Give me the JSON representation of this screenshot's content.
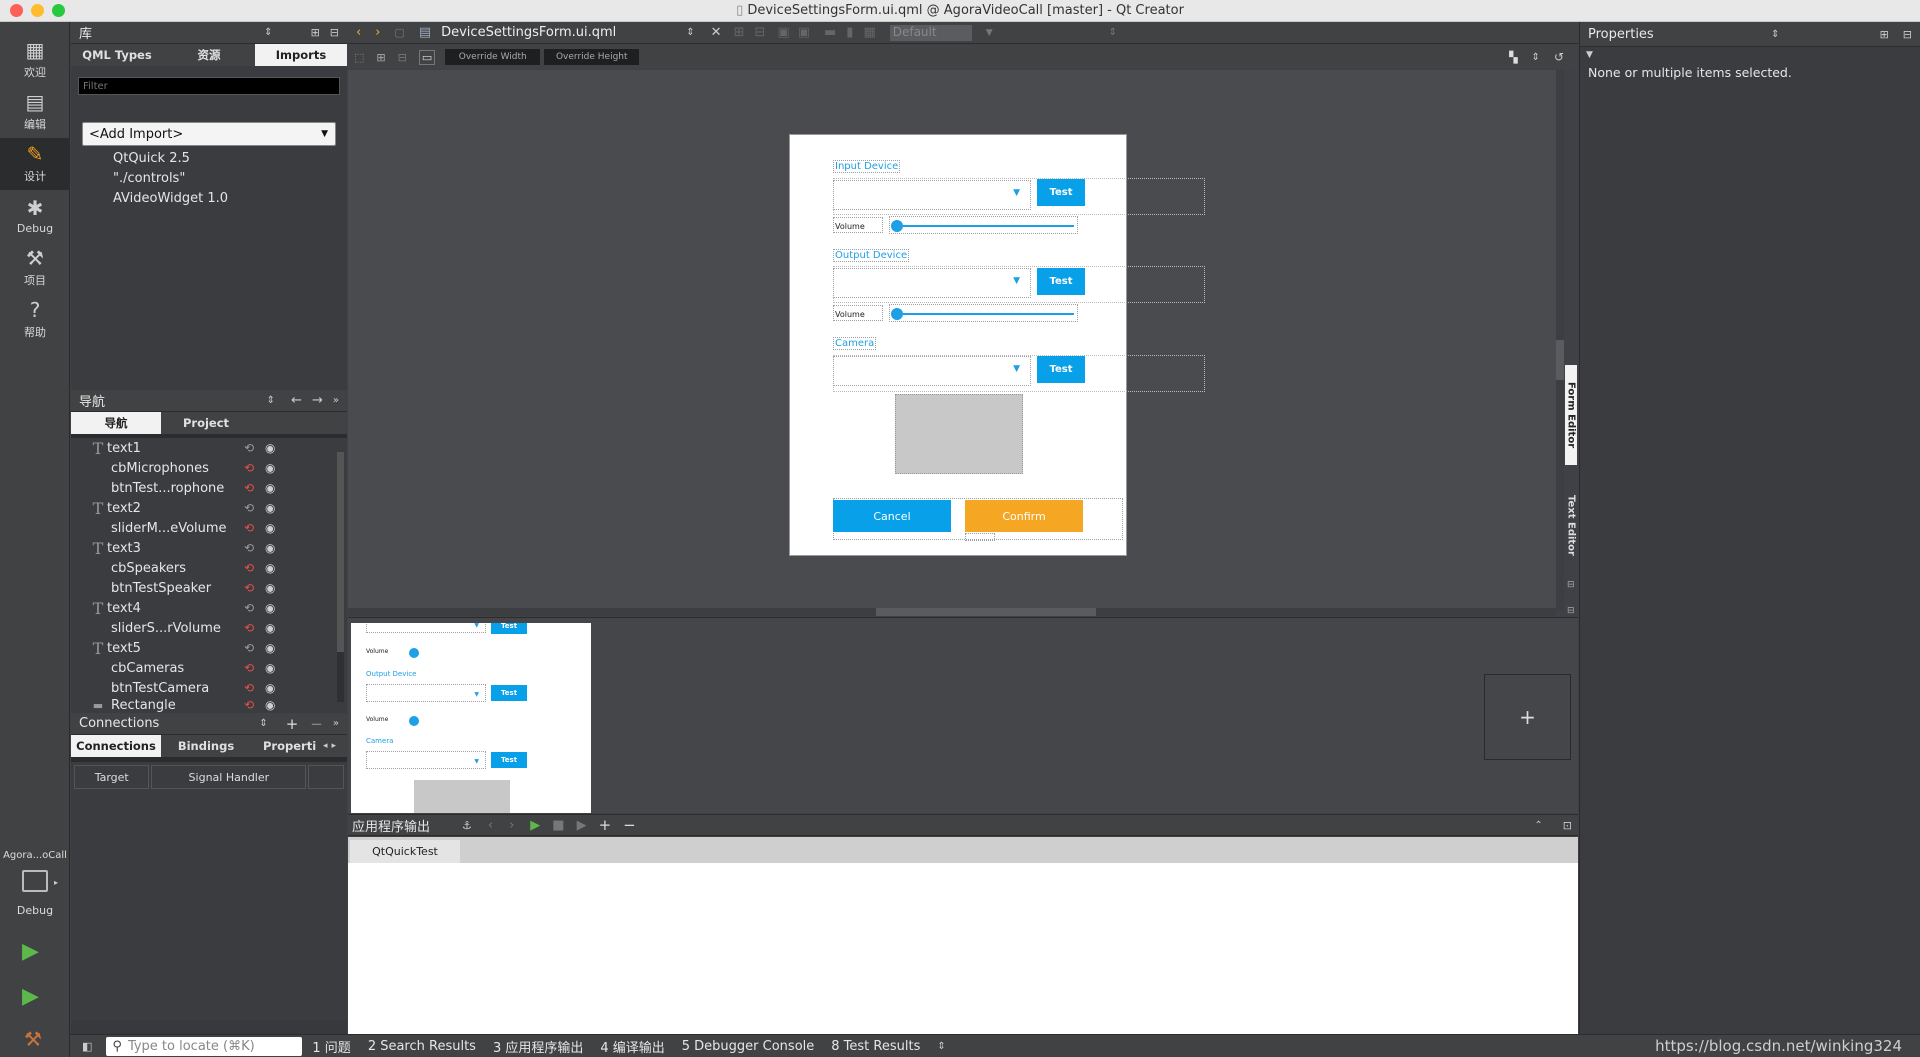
{
  "window": {
    "title": "DeviceSettingsForm.ui.qml @ AgoraVideoCall [master] - Qt Creator"
  },
  "modes": [
    {
      "label": "欢迎",
      "icon": "grid-icon"
    },
    {
      "label": "编辑",
      "icon": "edit-icon"
    },
    {
      "label": "设计",
      "icon": "pencil-icon"
    },
    {
      "label": "Debug",
      "icon": "bug-icon"
    },
    {
      "label": "项目",
      "icon": "wrench-icon"
    },
    {
      "label": "帮助",
      "icon": "help-icon"
    }
  ],
  "kit": {
    "name": "Agora...oCall",
    "config": "Debug"
  },
  "library": {
    "title": "库",
    "tabs": [
      "QML Types",
      "资源",
      "Imports"
    ],
    "filter_placeholder": "Filter",
    "add_import": "<Add Import>",
    "imports": [
      "QtQuick 2.5",
      "\"./controls\"",
      "AVideoWidget 1.0"
    ]
  },
  "navigator": {
    "title": "导航",
    "tabs": [
      "导航",
      "Project"
    ],
    "items": [
      {
        "name": "text1",
        "type": "text"
      },
      {
        "name": "cbMicrophones",
        "type": "item"
      },
      {
        "name": "btnTest...rophone",
        "type": "item"
      },
      {
        "name": "text2",
        "type": "text"
      },
      {
        "name": "sliderM...eVolume",
        "type": "item"
      },
      {
        "name": "text3",
        "type": "text"
      },
      {
        "name": "cbSpeakers",
        "type": "item"
      },
      {
        "name": "btnTestSpeaker",
        "type": "item"
      },
      {
        "name": "text4",
        "type": "text"
      },
      {
        "name": "sliderS...rVolume",
        "type": "item"
      },
      {
        "name": "text5",
        "type": "text"
      },
      {
        "name": "cbCameras",
        "type": "item"
      },
      {
        "name": "btnTestCamera",
        "type": "item"
      },
      {
        "name": "Rectangle",
        "type": "rect"
      }
    ]
  },
  "connections": {
    "title": "Connections",
    "tabs": [
      "Connections",
      "Bindings",
      "Properti"
    ],
    "columns": [
      "Target",
      "Signal Handler"
    ]
  },
  "editor": {
    "file": "DeviceSettingsForm.ui.qml",
    "state": "Default",
    "override_width": "Override Width",
    "override_height": "Override Height"
  },
  "form": {
    "input_device": "Input Device",
    "output_device": "Output Device",
    "camera": "Camera",
    "volume": "Volume",
    "test": "Test",
    "cancel": "Cancel",
    "confirm": "Confirm",
    "input_volume": 0.0,
    "output_volume": 0.0
  },
  "side_tabs": {
    "form_editor": "Form Editor",
    "text_editor": "Text Editor"
  },
  "properties": {
    "title": "Properties",
    "message": "None or multiple items selected."
  },
  "output": {
    "title": "应用程序输出",
    "tab": "QtQuickTest"
  },
  "statusbar": {
    "locate_placeholder": "Type to locate (⌘K)",
    "items": [
      "1 问题",
      "2 Search Results",
      "3 应用程序输出",
      "4 编译输出",
      "5 Debugger Console",
      "8 Test Results"
    ]
  },
  "watermark": "https://blog.csdn.net/winking324",
  "colors": {
    "accent": "#08a0e8",
    "confirm": "#f5a623",
    "selection": "#f0a020"
  }
}
